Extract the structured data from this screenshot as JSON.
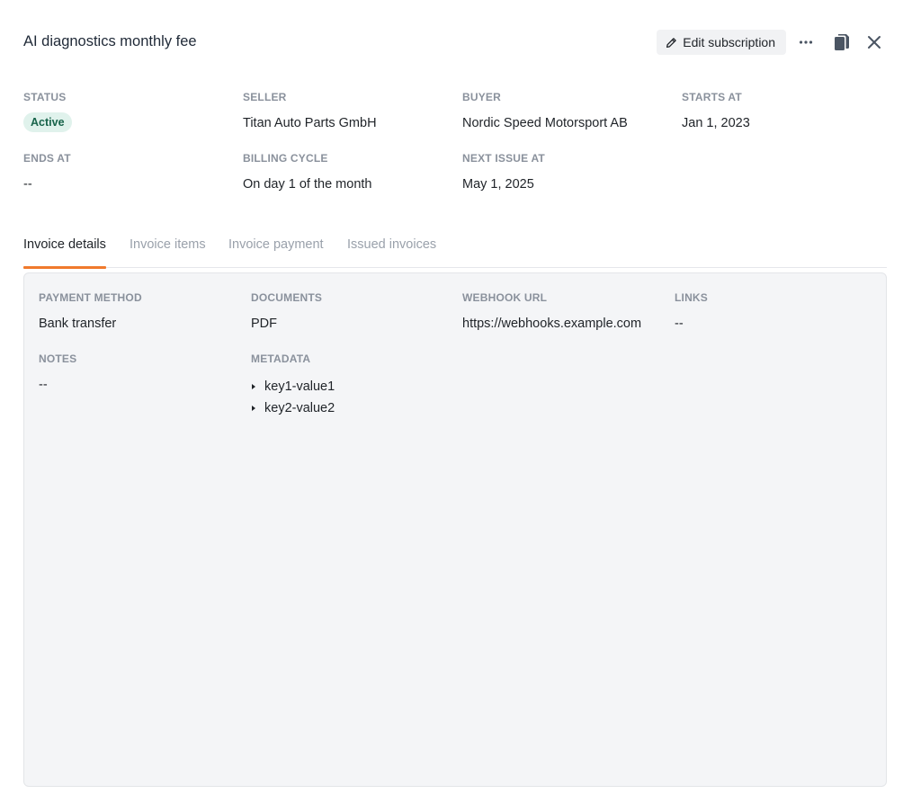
{
  "header": {
    "title": "AI diagnostics monthly fee",
    "edit_label": "Edit subscription"
  },
  "summary": {
    "status_label": "STATUS",
    "status_value": "Active",
    "seller_label": "SELLER",
    "seller_value": "Titan Auto Parts GmbH",
    "buyer_label": "BUYER",
    "buyer_value": "Nordic Speed Motorsport AB",
    "starts_label": "STARTS AT",
    "starts_value": "Jan 1, 2023",
    "ends_label": "ENDS AT",
    "ends_value": "--",
    "billing_label": "BILLING CYCLE",
    "billing_value": "On day 1 of the month",
    "next_issue_label": "NEXT ISSUE AT",
    "next_issue_value": "May 1, 2025"
  },
  "tabs": [
    {
      "label": "Invoice details",
      "active": true
    },
    {
      "label": "Invoice items",
      "active": false
    },
    {
      "label": "Invoice payment",
      "active": false
    },
    {
      "label": "Issued invoices",
      "active": false
    }
  ],
  "details": {
    "payment_method_label": "PAYMENT METHOD",
    "payment_method_value": "Bank transfer",
    "documents_label": "DOCUMENTS",
    "documents_value": "PDF",
    "webhook_label": "WEBHOOK URL",
    "webhook_value": "https://webhooks.example.com",
    "links_label": "LINKS",
    "links_value": "--",
    "notes_label": "NOTES",
    "notes_value": "--",
    "metadata_label": "METADATA",
    "metadata_items": [
      "key1-value1",
      "key2-value2"
    ]
  },
  "colors": {
    "accent": "#f07a2c",
    "badge_bg": "#e0f2ec",
    "badge_text": "#17634a"
  },
  "icons": {
    "edit": "pencil-icon",
    "more": "more-horizontal-icon",
    "copy": "copy-icon",
    "close": "close-icon"
  }
}
